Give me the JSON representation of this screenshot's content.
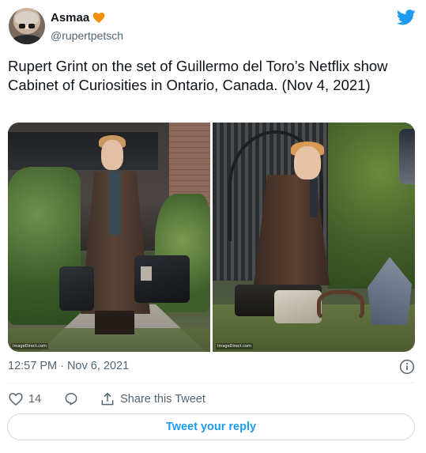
{
  "author": {
    "display_name": "Asmaa",
    "badge_icon": "orange-heart-icon",
    "handle": "@rupertpetsch"
  },
  "brand_icon": "twitter-bird-icon",
  "tweet": {
    "text": "Rupert Grint on the set of Guillermo del Toro’s Netflix show Cabinet of Curiosities in Ontario, Canada. (Nov 4, 2021)",
    "timestamp": "12:57 PM · Nov 6, 2021"
  },
  "media": {
    "photos": [
      {
        "watermark": "ImageDirect.com"
      },
      {
        "watermark": "ImageDirect.com"
      }
    ]
  },
  "actions": {
    "like_count": "14",
    "share_label": "Share this Tweet"
  },
  "reply_label": "Tweet your reply",
  "colors": {
    "accent": "#1d9bf0",
    "heart": "#f4900c",
    "secondary_text": "#536471",
    "border": "#cfd9de"
  }
}
